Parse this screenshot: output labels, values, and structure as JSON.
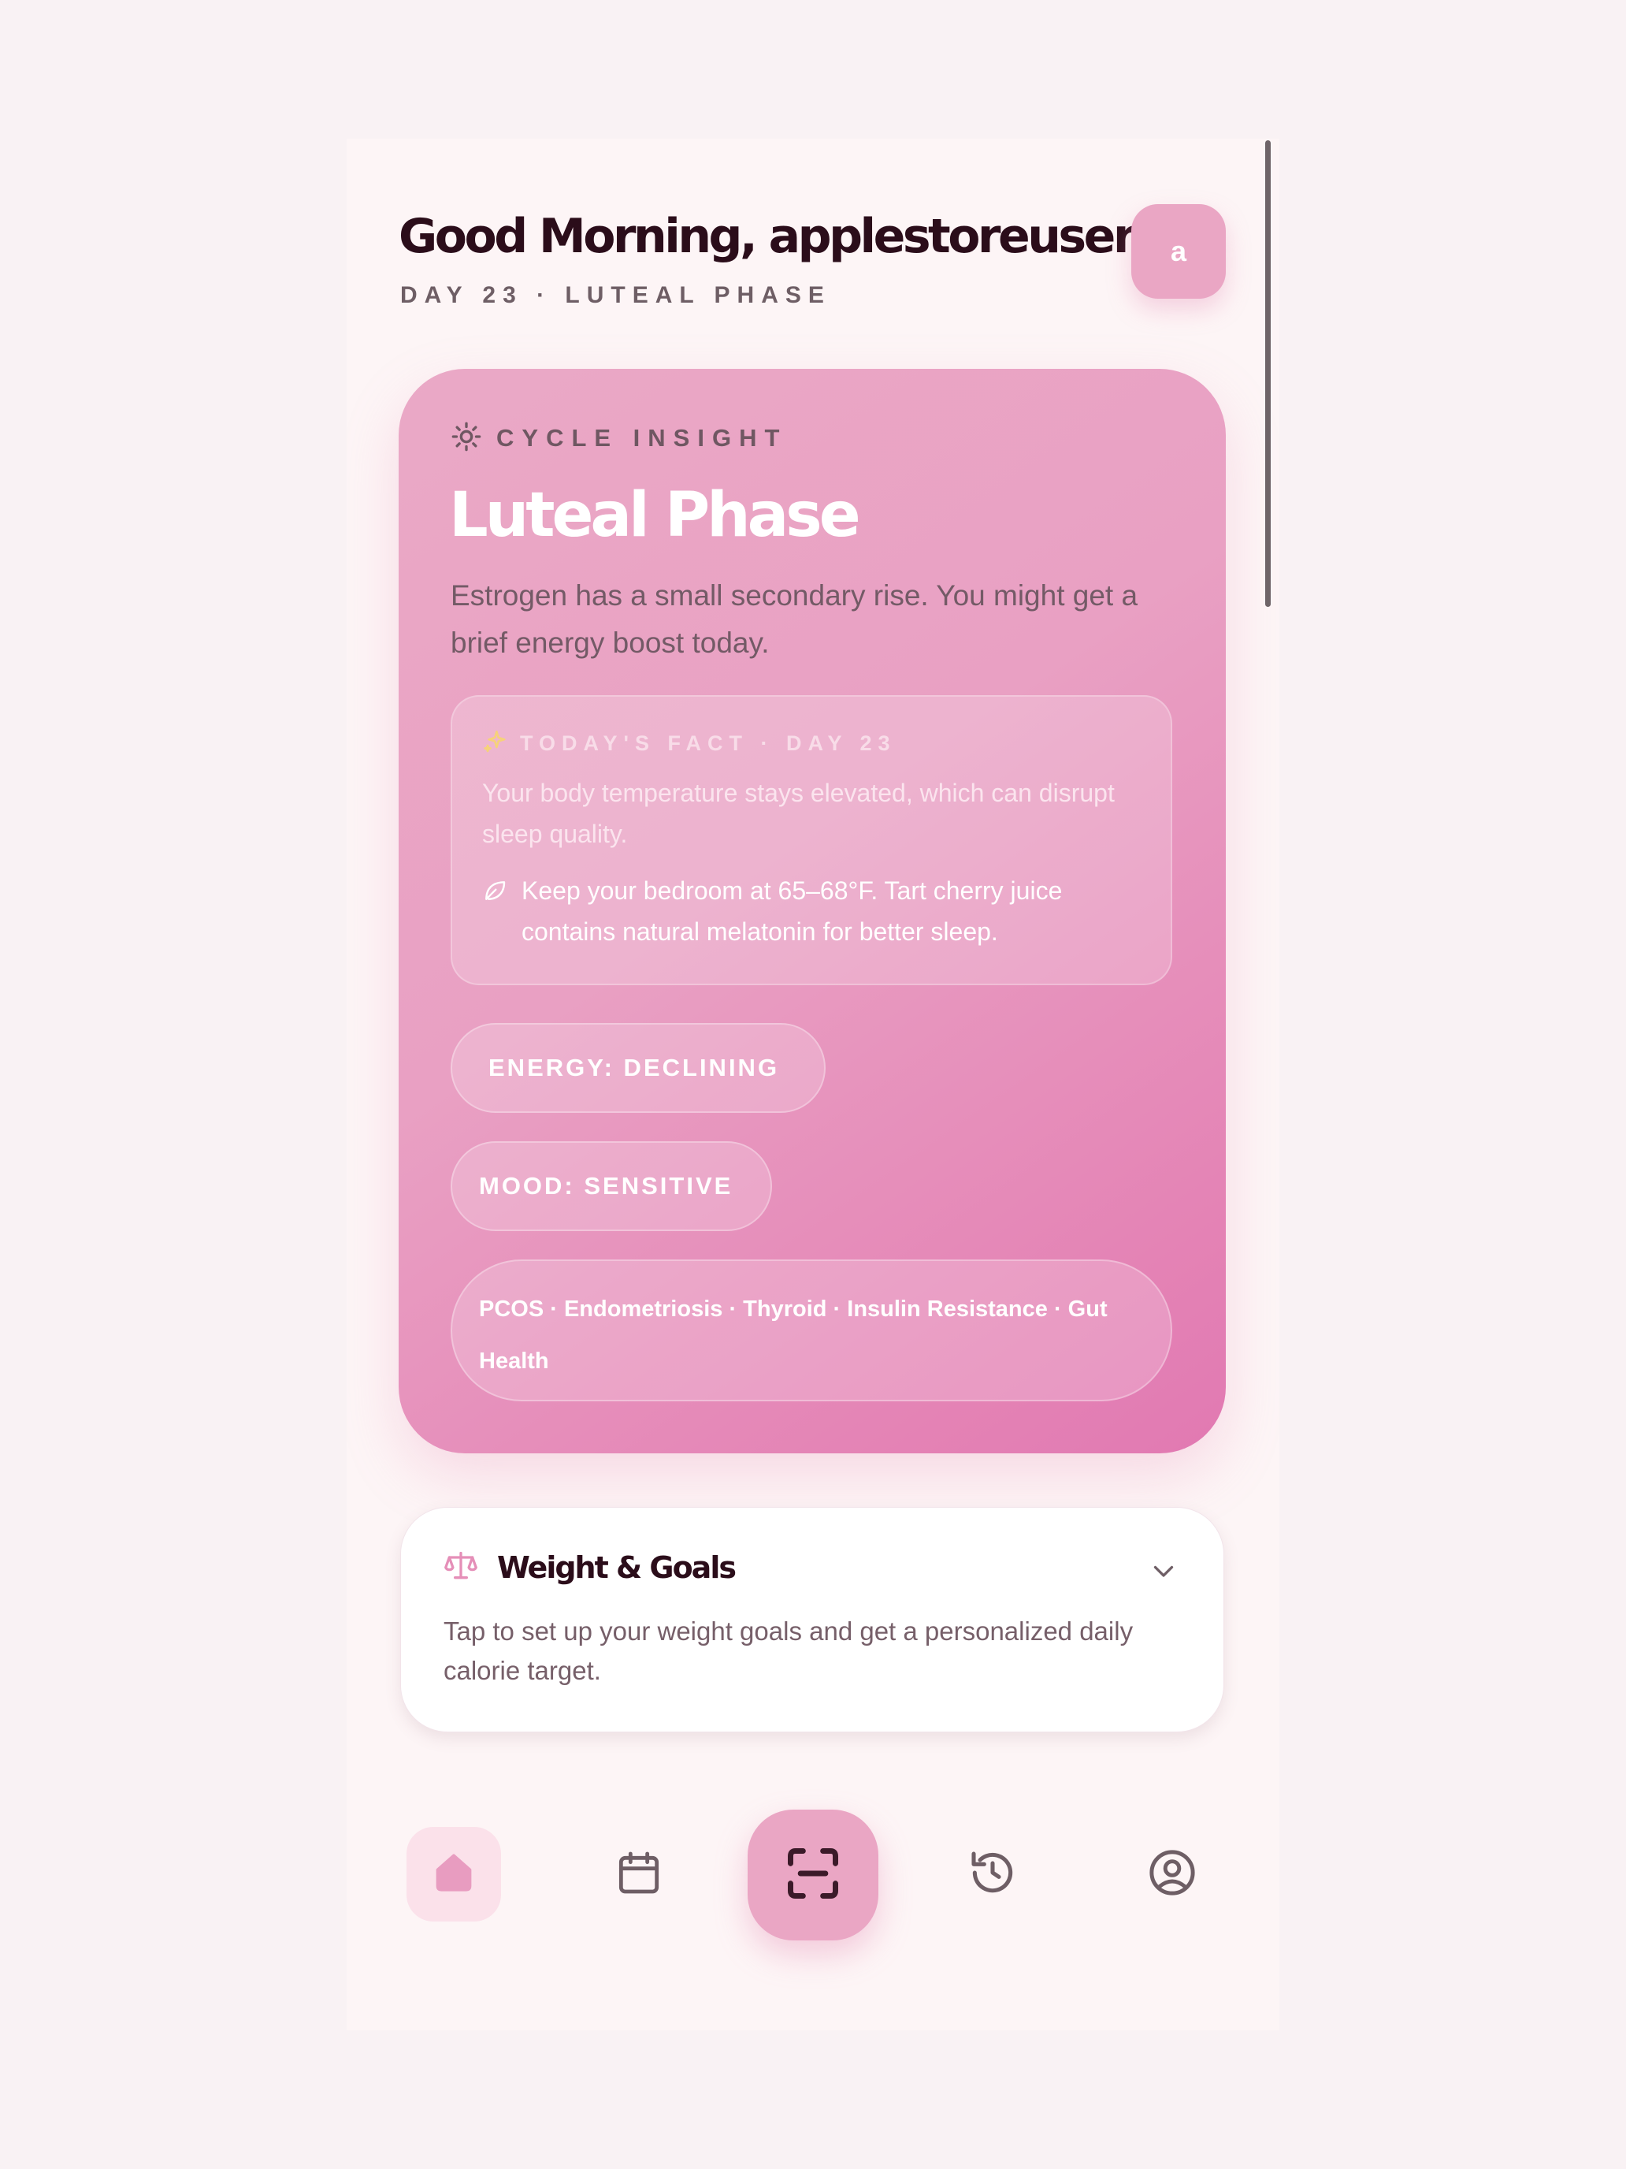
{
  "header": {
    "greeting": "Good Morning, applestoreuser",
    "subtitle": "DAY 23 · LUTEAL PHASE",
    "avatar_letter": "a"
  },
  "insight": {
    "label": "CYCLE INSIGHT",
    "icon": "sun-icon",
    "phase_title": "Luteal Phase",
    "description": "Estrogen has a small secondary rise. You might get a brief energy boost today.",
    "fact": {
      "label": "TODAY'S FACT · DAY 23",
      "icon": "sparkles-icon",
      "text": "Your body temperature stays elevated, which can disrupt sleep quality.",
      "tip_icon": "leaf-icon",
      "tip": "Keep your bedroom at 65–68°F. Tart cherry juice contains natural melatonin for better sleep."
    },
    "energy_pill": "ENERGY: DECLINING",
    "mood_pill": "MOOD: SENSITIVE",
    "conditions": "PCOS · Endometriosis · Thyroid · Insulin Resistance · Gut Health"
  },
  "weight_card": {
    "icon": "scale-icon",
    "title": "Weight & Goals",
    "description": "Tap to set up your weight goals and get a personalized daily calorie target.",
    "chevron_icon": "chevron-down-icon"
  },
  "nav": {
    "items": [
      {
        "icon": "home-icon",
        "active": true
      },
      {
        "icon": "calendar-icon",
        "active": false
      },
      {
        "icon": "scan-icon",
        "active": false
      },
      {
        "icon": "history-icon",
        "active": false
      },
      {
        "icon": "profile-icon",
        "active": false
      }
    ]
  },
  "colors": {
    "page_bg": "#f9f2f4",
    "screen_bg": "#fdf5f6",
    "accent_pink": "#eaa6c4",
    "card_gradient_start": "#eaa9c6",
    "card_gradient_end": "#e179b2",
    "title_dark": "#2b0d1a",
    "muted_text": "#6e5e65",
    "fact_icon_yellow": "#f6d27a"
  }
}
